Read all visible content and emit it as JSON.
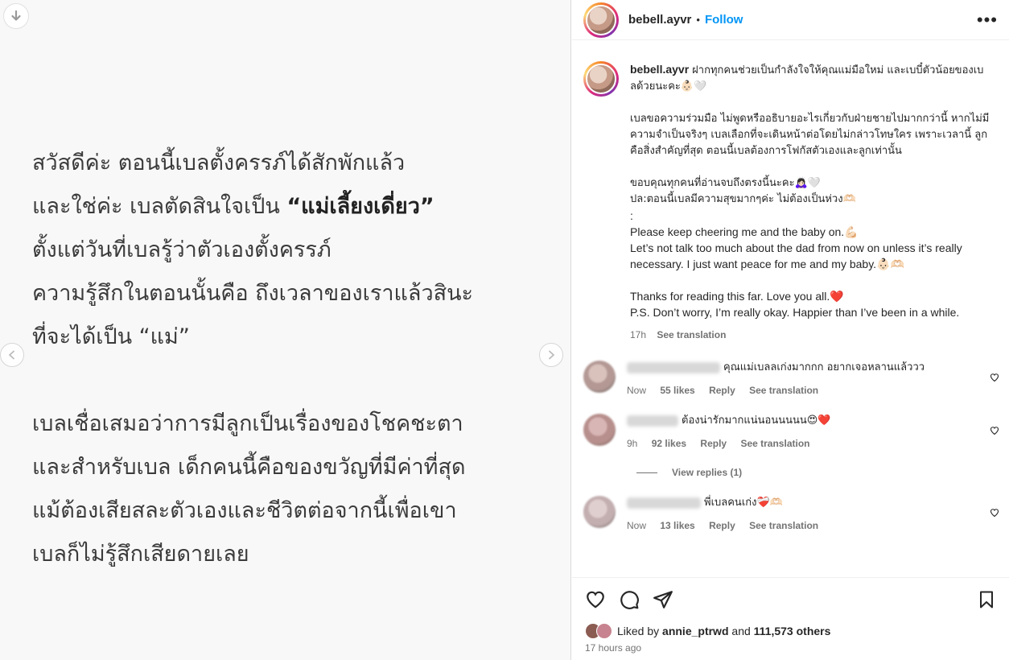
{
  "media": {
    "paragraphs": [
      {
        "lines": [
          [
            "สวัสดีค่ะ ตอนนี้เบลตั้งครรภ์ได้สักพักแล้ว"
          ],
          [
            "และใช่ค่ะ เบลตัดสินใจเป็น ",
            "“แม่เลี้ยงเดี่ยว”"
          ],
          [
            "ตั้งแต่วันที่เบลรู้ว่าตัวเองตั้งครรภ์"
          ],
          [
            "ความรู้สึกในตอนนั้นคือ ถึงเวลาของเราแล้วสินะ"
          ],
          [
            "ที่จะได้เป็น “แม่”"
          ]
        ]
      },
      {
        "lines": [
          [
            "เบลเชื่อเสมอว่าการมีลูกเป็นเรื่องของโชคชะตา"
          ],
          [
            "และสำหรับเบล เด็กคนนี้คือของขวัญที่มีค่าที่สุด"
          ],
          [
            "แม้ต้องเสียสละตัวเองและชีวิตต่อจากนี้เพื่อเขา"
          ],
          [
            "เบลก็ไม่รู้สึกเสียดายเลย"
          ]
        ]
      }
    ],
    "download_icon": "arrow-down-icon",
    "prev_icon": "chevron-left-icon",
    "next_icon": "chevron-right-icon"
  },
  "header": {
    "username": "bebell.ayvr",
    "separator": "•",
    "follow_label": "Follow",
    "more_label": "•••"
  },
  "caption": {
    "username": "bebell.ayvr",
    "line1": "ฝากทุกคนช่วยเป็นกำลังใจให้คุณแม่มือใหม่ และเบบี๋ตัวน้อยของเบลด้วยนะคะ👶🏻🤍",
    "line2": "เบลขอความร่วมมือ ไม่พูดหรืออธิบายอะไรเกี่ยวกับฝ่ายชายไปมากกว่านี้ หากไม่มีความจำเป็นจริงๆ เบลเลือกที่จะเดินหน้าต่อโดยไม่กล่าวโทษใคร เพราะเวลานี้ ลูกคือสิ่งสำคัญที่สุด ตอนนี้เบลต้องการโฟกัสตัวเองและลูกเท่านั้น",
    "line3": "ขอบคุณทุกคนที่อ่านจบถึงตรงนี้นะคะ🙇🏻‍♀️🤍",
    "line4": "ปล:ตอนนี้เบลมีความสุขมากๆค่ะ ไม่ต้องเป็นห่วง🫶🏻",
    "line5": ":",
    "line6": "Please keep cheering me and the baby on.💪🏻",
    "line7": "Let’s not talk too much about the dad from now on unless it’s really necessary. I just want peace for me and my baby.👶🏻🫶🏻",
    "line8": "Thanks for reading this far. Love you all.❤️",
    "line9": "P.S. Don’t worry, I’m really okay. Happier than I’ve been in a while.",
    "time": "17h",
    "see_translation": "See translation"
  },
  "comments": [
    {
      "text": "คุณแม่เบลลเก่งมากกก อยากเจอหลานแล้ววว",
      "time": "Now",
      "likes": "55 likes",
      "reply": "Reply",
      "see_translation": "See translation"
    },
    {
      "text": "ต้องน่ารักมากแน่นอนนนนน😍❤️",
      "time": "9h",
      "likes": "92 likes",
      "reply": "Reply",
      "see_translation": "See translation",
      "view_replies": "View replies (1)"
    },
    {
      "text": "พี่เบลคนเก่ง❤️‍🩹🫶🏻",
      "time": "Now",
      "likes": "13 likes",
      "reply": "Reply",
      "see_translation": "See translation"
    }
  ],
  "footer": {
    "liked_by_prefix": "Liked by",
    "liked_by_user": "annie_ptrwd",
    "and": "and",
    "others": "111,573 others",
    "time_ago": "17 hours ago"
  },
  "icons": {
    "like": "heart-icon",
    "comment": "comment-icon",
    "share": "share-icon",
    "save": "bookmark-icon"
  }
}
